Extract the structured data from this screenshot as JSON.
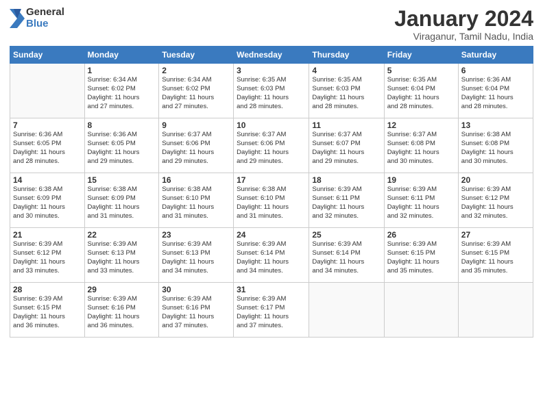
{
  "logo": {
    "general": "General",
    "blue": "Blue"
  },
  "title": "January 2024",
  "subtitle": "Viraganur, Tamil Nadu, India",
  "days": [
    "Sunday",
    "Monday",
    "Tuesday",
    "Wednesday",
    "Thursday",
    "Friday",
    "Saturday"
  ],
  "weeks": [
    [
      {
        "num": "",
        "info": ""
      },
      {
        "num": "1",
        "info": "Sunrise: 6:34 AM\nSunset: 6:02 PM\nDaylight: 11 hours\nand 27 minutes."
      },
      {
        "num": "2",
        "info": "Sunrise: 6:34 AM\nSunset: 6:02 PM\nDaylight: 11 hours\nand 27 minutes."
      },
      {
        "num": "3",
        "info": "Sunrise: 6:35 AM\nSunset: 6:03 PM\nDaylight: 11 hours\nand 28 minutes."
      },
      {
        "num": "4",
        "info": "Sunrise: 6:35 AM\nSunset: 6:03 PM\nDaylight: 11 hours\nand 28 minutes."
      },
      {
        "num": "5",
        "info": "Sunrise: 6:35 AM\nSunset: 6:04 PM\nDaylight: 11 hours\nand 28 minutes."
      },
      {
        "num": "6",
        "info": "Sunrise: 6:36 AM\nSunset: 6:04 PM\nDaylight: 11 hours\nand 28 minutes."
      }
    ],
    [
      {
        "num": "7",
        "info": "Sunrise: 6:36 AM\nSunset: 6:05 PM\nDaylight: 11 hours\nand 28 minutes."
      },
      {
        "num": "8",
        "info": "Sunrise: 6:36 AM\nSunset: 6:05 PM\nDaylight: 11 hours\nand 29 minutes."
      },
      {
        "num": "9",
        "info": "Sunrise: 6:37 AM\nSunset: 6:06 PM\nDaylight: 11 hours\nand 29 minutes."
      },
      {
        "num": "10",
        "info": "Sunrise: 6:37 AM\nSunset: 6:06 PM\nDaylight: 11 hours\nand 29 minutes."
      },
      {
        "num": "11",
        "info": "Sunrise: 6:37 AM\nSunset: 6:07 PM\nDaylight: 11 hours\nand 29 minutes."
      },
      {
        "num": "12",
        "info": "Sunrise: 6:37 AM\nSunset: 6:08 PM\nDaylight: 11 hours\nand 30 minutes."
      },
      {
        "num": "13",
        "info": "Sunrise: 6:38 AM\nSunset: 6:08 PM\nDaylight: 11 hours\nand 30 minutes."
      }
    ],
    [
      {
        "num": "14",
        "info": "Sunrise: 6:38 AM\nSunset: 6:09 PM\nDaylight: 11 hours\nand 30 minutes."
      },
      {
        "num": "15",
        "info": "Sunrise: 6:38 AM\nSunset: 6:09 PM\nDaylight: 11 hours\nand 31 minutes."
      },
      {
        "num": "16",
        "info": "Sunrise: 6:38 AM\nSunset: 6:10 PM\nDaylight: 11 hours\nand 31 minutes."
      },
      {
        "num": "17",
        "info": "Sunrise: 6:38 AM\nSunset: 6:10 PM\nDaylight: 11 hours\nand 31 minutes."
      },
      {
        "num": "18",
        "info": "Sunrise: 6:39 AM\nSunset: 6:11 PM\nDaylight: 11 hours\nand 32 minutes."
      },
      {
        "num": "19",
        "info": "Sunrise: 6:39 AM\nSunset: 6:11 PM\nDaylight: 11 hours\nand 32 minutes."
      },
      {
        "num": "20",
        "info": "Sunrise: 6:39 AM\nSunset: 6:12 PM\nDaylight: 11 hours\nand 32 minutes."
      }
    ],
    [
      {
        "num": "21",
        "info": "Sunrise: 6:39 AM\nSunset: 6:12 PM\nDaylight: 11 hours\nand 33 minutes."
      },
      {
        "num": "22",
        "info": "Sunrise: 6:39 AM\nSunset: 6:13 PM\nDaylight: 11 hours\nand 33 minutes."
      },
      {
        "num": "23",
        "info": "Sunrise: 6:39 AM\nSunset: 6:13 PM\nDaylight: 11 hours\nand 34 minutes."
      },
      {
        "num": "24",
        "info": "Sunrise: 6:39 AM\nSunset: 6:14 PM\nDaylight: 11 hours\nand 34 minutes."
      },
      {
        "num": "25",
        "info": "Sunrise: 6:39 AM\nSunset: 6:14 PM\nDaylight: 11 hours\nand 34 minutes."
      },
      {
        "num": "26",
        "info": "Sunrise: 6:39 AM\nSunset: 6:15 PM\nDaylight: 11 hours\nand 35 minutes."
      },
      {
        "num": "27",
        "info": "Sunrise: 6:39 AM\nSunset: 6:15 PM\nDaylight: 11 hours\nand 35 minutes."
      }
    ],
    [
      {
        "num": "28",
        "info": "Sunrise: 6:39 AM\nSunset: 6:15 PM\nDaylight: 11 hours\nand 36 minutes."
      },
      {
        "num": "29",
        "info": "Sunrise: 6:39 AM\nSunset: 6:16 PM\nDaylight: 11 hours\nand 36 minutes."
      },
      {
        "num": "30",
        "info": "Sunrise: 6:39 AM\nSunset: 6:16 PM\nDaylight: 11 hours\nand 37 minutes."
      },
      {
        "num": "31",
        "info": "Sunrise: 6:39 AM\nSunset: 6:17 PM\nDaylight: 11 hours\nand 37 minutes."
      },
      {
        "num": "",
        "info": ""
      },
      {
        "num": "",
        "info": ""
      },
      {
        "num": "",
        "info": ""
      }
    ]
  ]
}
